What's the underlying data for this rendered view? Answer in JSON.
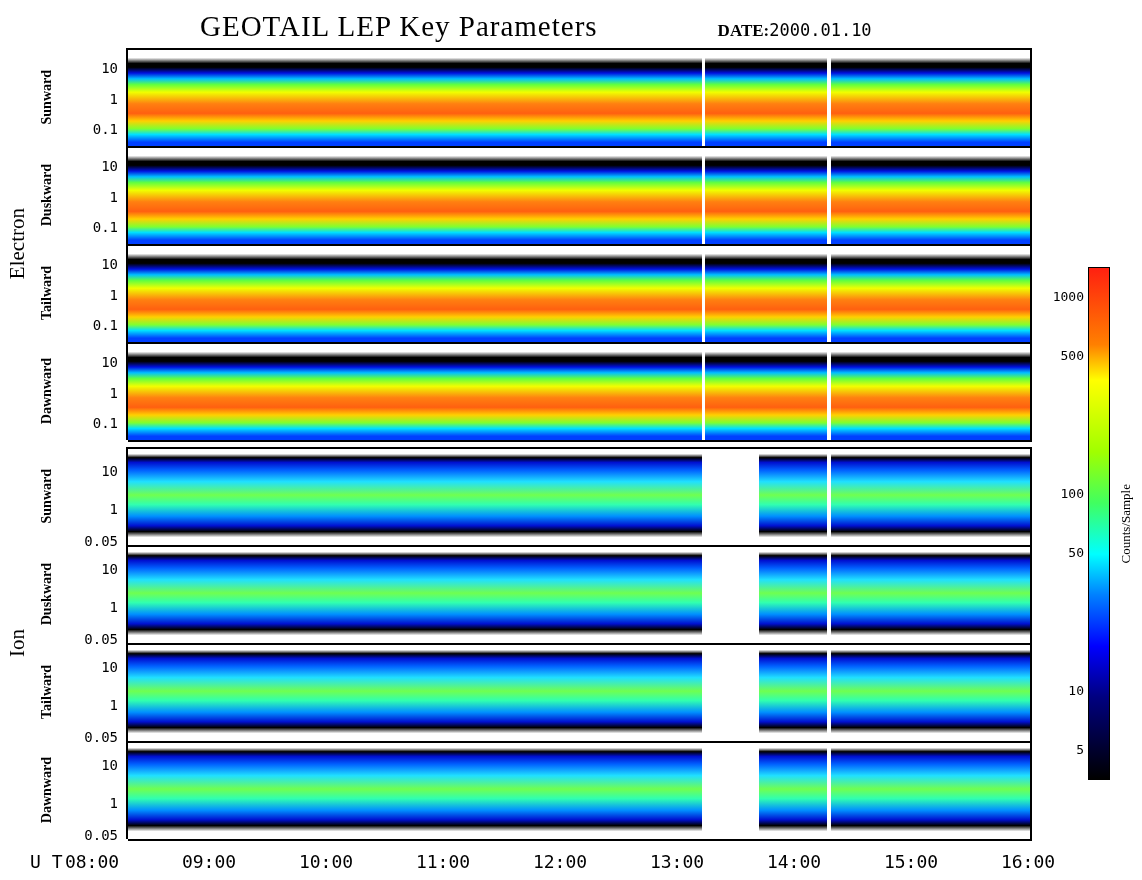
{
  "title": "GEOTAIL LEP Key Parameters",
  "date_label": "DATE:",
  "date": "2000.01.10",
  "groups": [
    {
      "name": "Electron",
      "kind": "electron",
      "panels": [
        {
          "direction": "Sunward",
          "yticks": [
            "10",
            "1",
            "0.1"
          ]
        },
        {
          "direction": "Duskward",
          "yticks": [
            "10",
            "1",
            "0.1"
          ]
        },
        {
          "direction": "Tailward",
          "yticks": [
            "10",
            "1",
            "0.1"
          ]
        },
        {
          "direction": "Dawnward",
          "yticks": [
            "10",
            "1",
            "0.1"
          ]
        }
      ]
    },
    {
      "name": "Ion",
      "kind": "ion",
      "panels": [
        {
          "direction": "Sunward",
          "yticks": [
            "10",
            "1",
            "0.05"
          ]
        },
        {
          "direction": "Duskward",
          "yticks": [
            "10",
            "1",
            "0.05"
          ]
        },
        {
          "direction": "Tailward",
          "yticks": [
            "10",
            "1",
            "0.05"
          ]
        },
        {
          "direction": "Dawnward",
          "yticks": [
            "10",
            "1",
            "0.05"
          ]
        }
      ]
    }
  ],
  "xaxis": {
    "label": "U T",
    "ticks": [
      "08:00",
      "09:00",
      "10:00",
      "11:00",
      "12:00",
      "13:00",
      "14:00",
      "15:00",
      "16:00"
    ]
  },
  "colorbar": {
    "label": "Counts/Sample",
    "ticks": [
      "1000",
      "500",
      "100",
      "50",
      "10",
      "5"
    ]
  }
}
